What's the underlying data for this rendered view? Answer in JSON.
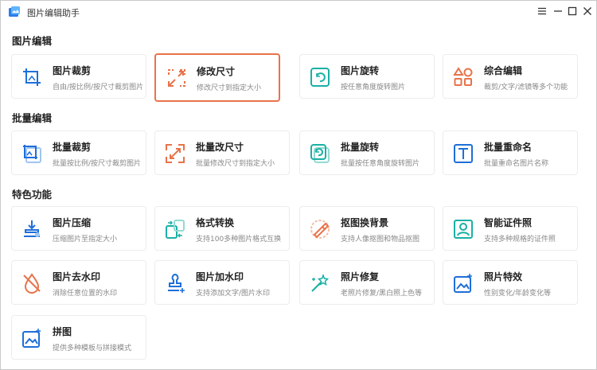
{
  "window": {
    "title": "图片编辑助手"
  },
  "colors": {
    "accent_blue": "#1e6fd9",
    "accent_orange": "#e8734a",
    "accent_teal": "#1ab0a5"
  },
  "sections": [
    {
      "title": "图片编辑",
      "cards": [
        {
          "name": "图片裁剪",
          "desc": "自由/按比例/按尺寸裁剪图片",
          "icon": "crop-icon"
        },
        {
          "name": "修改尺寸",
          "desc": "修改尺寸到指定大小",
          "icon": "resize-icon",
          "selected": true
        },
        {
          "name": "图片旋转",
          "desc": "按任意角度旋转图片",
          "icon": "rotate-icon"
        },
        {
          "name": "综合编辑",
          "desc": "裁剪/文字/滤镜等多个功能",
          "icon": "shapes-icon"
        }
      ]
    },
    {
      "title": "批量编辑",
      "cards": [
        {
          "name": "批量裁剪",
          "desc": "批量按比例/按尺寸裁剪图片",
          "icon": "batch-crop-icon"
        },
        {
          "name": "批量改尺寸",
          "desc": "批量修改尺寸到指定大小",
          "icon": "batch-resize-icon"
        },
        {
          "name": "批量旋转",
          "desc": "批量按任意角度旋转图片",
          "icon": "batch-rotate-icon"
        },
        {
          "name": "批量重命名",
          "desc": "批量重命名图片名称",
          "icon": "rename-icon"
        }
      ]
    },
    {
      "title": "特色功能",
      "cards": [
        {
          "name": "图片压缩",
          "desc": "压缩图片至指定大小",
          "icon": "compress-icon"
        },
        {
          "name": "格式转换",
          "desc": "支持100多种图片格式互换",
          "icon": "convert-icon"
        },
        {
          "name": "抠图换背景",
          "desc": "支持人像抠图和物品抠图",
          "icon": "cutout-icon"
        },
        {
          "name": "智能证件照",
          "desc": "支持多种规格的证件照",
          "icon": "id-photo-icon"
        },
        {
          "name": "图片去水印",
          "desc": "消除任意位置的水印",
          "icon": "remove-watermark-icon"
        },
        {
          "name": "图片加水印",
          "desc": "支持添加文字/图片水印",
          "icon": "add-watermark-icon"
        },
        {
          "name": "照片修复",
          "desc": "老照片修复/黑白照上色等",
          "icon": "magic-wand-icon"
        },
        {
          "name": "照片特效",
          "desc": "性别变化/年龄变化等",
          "icon": "photo-effect-icon"
        },
        {
          "name": "拼图",
          "desc": "提供多种模板与拼接模式",
          "icon": "collage-icon"
        }
      ]
    }
  ]
}
